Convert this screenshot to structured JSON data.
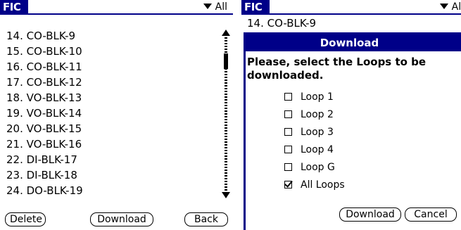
{
  "left": {
    "app_title": "FIC",
    "category": "All",
    "items": [
      "14. CO-BLK-9",
      "15. CO-BLK-10",
      "16. CO-BLK-11",
      "17. CO-BLK-12",
      "18. VO-BLK-13",
      "19. VO-BLK-14",
      "20. VO-BLK-15",
      "21. VO-BLK-16",
      "22. DI-BLK-17",
      "23. DI-BLK-18",
      "24. DO-BLK-19"
    ],
    "buttons": {
      "delete": "Delete",
      "download": "Download",
      "back": "Back"
    }
  },
  "right": {
    "app_title": "FIC",
    "category": "All",
    "background_item": "14. CO-BLK-9",
    "dialog": {
      "title": "Download",
      "message": "Please, select the Loops to be downloaded.",
      "options": [
        {
          "label": "Loop 1",
          "checked": false
        },
        {
          "label": "Loop 2",
          "checked": false
        },
        {
          "label": "Loop 3",
          "checked": false
        },
        {
          "label": "Loop 4",
          "checked": false
        },
        {
          "label": "Loop G",
          "checked": false
        },
        {
          "label": "All Loops",
          "checked": true
        }
      ],
      "buttons": {
        "download": "Download",
        "cancel": "Cancel"
      }
    }
  },
  "colors": {
    "accent": "#000088"
  }
}
